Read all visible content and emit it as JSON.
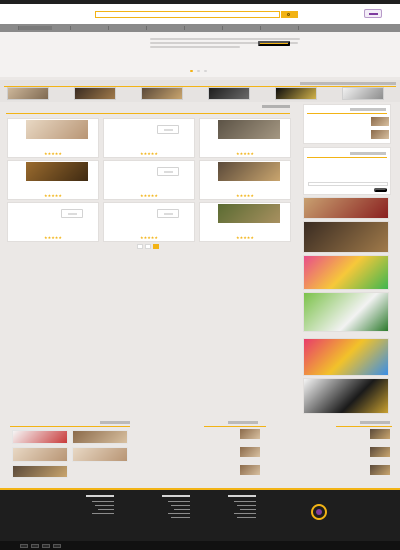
{
  "topbar": {
    "text": ""
  },
  "header": {
    "logo": {
      "icon": "logo-icon",
      "text": ""
    },
    "search": {
      "value": "",
      "placeholder": ""
    },
    "search_button": {
      "icon": "search-icon"
    }
  },
  "nav": {
    "items": [
      "",
      "",
      "",
      "",
      "",
      "",
      "",
      ""
    ],
    "active_index": 0
  },
  "hero": {
    "text": "",
    "cta_label": "",
    "slides": 3,
    "active_slide": 0
  },
  "category_strip": {
    "title": "",
    "items": [
      {
        "label": "",
        "icon": "buffet-photo"
      },
      {
        "label": "",
        "icon": "sweets-photo"
      },
      {
        "label": "",
        "icon": "hall-photo"
      },
      {
        "label": "",
        "icon": "catering-photo"
      },
      {
        "label": "",
        "icon": "decoration-photo"
      },
      {
        "label": "",
        "icon": "dining-photo"
      }
    ]
  },
  "products": {
    "title": "",
    "items": [
      {
        "name": "",
        "shop": "",
        "rating": 5,
        "image": "bakery-photo"
      },
      {
        "name": "",
        "shop": "",
        "rating": 5,
        "image": "placeholder-logo"
      },
      {
        "name": "",
        "shop": "",
        "rating": 5,
        "image": "interior-photo"
      },
      {
        "name": "",
        "shop": "",
        "rating": 5,
        "image": "hall-photo"
      },
      {
        "name": "",
        "shop": "",
        "rating": 5,
        "image": "placeholder-logo"
      },
      {
        "name": "",
        "shop": "",
        "rating": 5,
        "image": "sign-photo"
      },
      {
        "name": "",
        "shop": "",
        "rating": 5,
        "image": "garden-photo"
      },
      {
        "name": "",
        "shop": "",
        "rating": 5,
        "image": "placeholder-logo"
      },
      {
        "name": "",
        "shop": "",
        "rating": 5,
        "image": "placeholder-logo"
      }
    ]
  },
  "pagination": {
    "pages": [
      "",
      "",
      ""
    ],
    "active": 2
  },
  "sidebar": {
    "list_box": {
      "title": "",
      "items": [
        {
          "title": "",
          "subtitle": "",
          "image": "room-photo"
        },
        {
          "title": "",
          "subtitle": "",
          "image": "room-photo"
        }
      ]
    },
    "form": {
      "title": "",
      "description": "",
      "input_value": "",
      "input_placeholder": "",
      "submit_label": ""
    },
    "ads": [
      {
        "icon": "party-photo"
      },
      {
        "icon": "sweets-photo"
      },
      {
        "icon": "jelly-cups-photo"
      },
      {
        "icon": "football-party-photo"
      },
      {
        "icon": "balloons-photo"
      },
      {
        "icon": "masks-photo"
      }
    ]
  },
  "lower": {
    "list_a": {
      "title": "",
      "items": [
        {
          "title": "",
          "subtitle": "",
          "image": "hall-photo"
        },
        {
          "title": "",
          "subtitle": "",
          "image": "hall-photo"
        },
        {
          "title": "",
          "subtitle": "",
          "image": "hall-photo"
        }
      ]
    },
    "list_b": {
      "title": "",
      "items": [
        {
          "title": "",
          "subtitle": "",
          "image": "room-photo"
        },
        {
          "title": "",
          "subtitle": "",
          "image": "room-photo"
        },
        {
          "title": "",
          "subtitle": "",
          "image": "room-photo"
        }
      ]
    },
    "gallery": {
      "title": "",
      "items": [
        {
          "icon": "decor-photo"
        },
        {
          "icon": "room-photo"
        },
        {
          "icon": "interior-photo"
        },
        {
          "icon": "interior-photo"
        },
        {
          "icon": "hall-photo"
        }
      ]
    }
  },
  "footer": {
    "columns": [
      {
        "title": "",
        "links": [
          "",
          "",
          "",
          "",
          ""
        ]
      },
      {
        "title": "",
        "links": [
          "",
          "",
          "",
          "",
          ""
        ]
      },
      {
        "title": "",
        "links": [
          "",
          "",
          "",
          ""
        ]
      }
    ],
    "logo": {
      "icon": "footer-logo-icon",
      "text": ""
    },
    "copyright": ""
  },
  "colors": {
    "accent": "#f2b315",
    "nav": "#8a8a8a",
    "footer": "#1e1e1e",
    "page": "#ebe8e6",
    "brand": "#7d3b9e",
    "price": "#c94c4c"
  }
}
